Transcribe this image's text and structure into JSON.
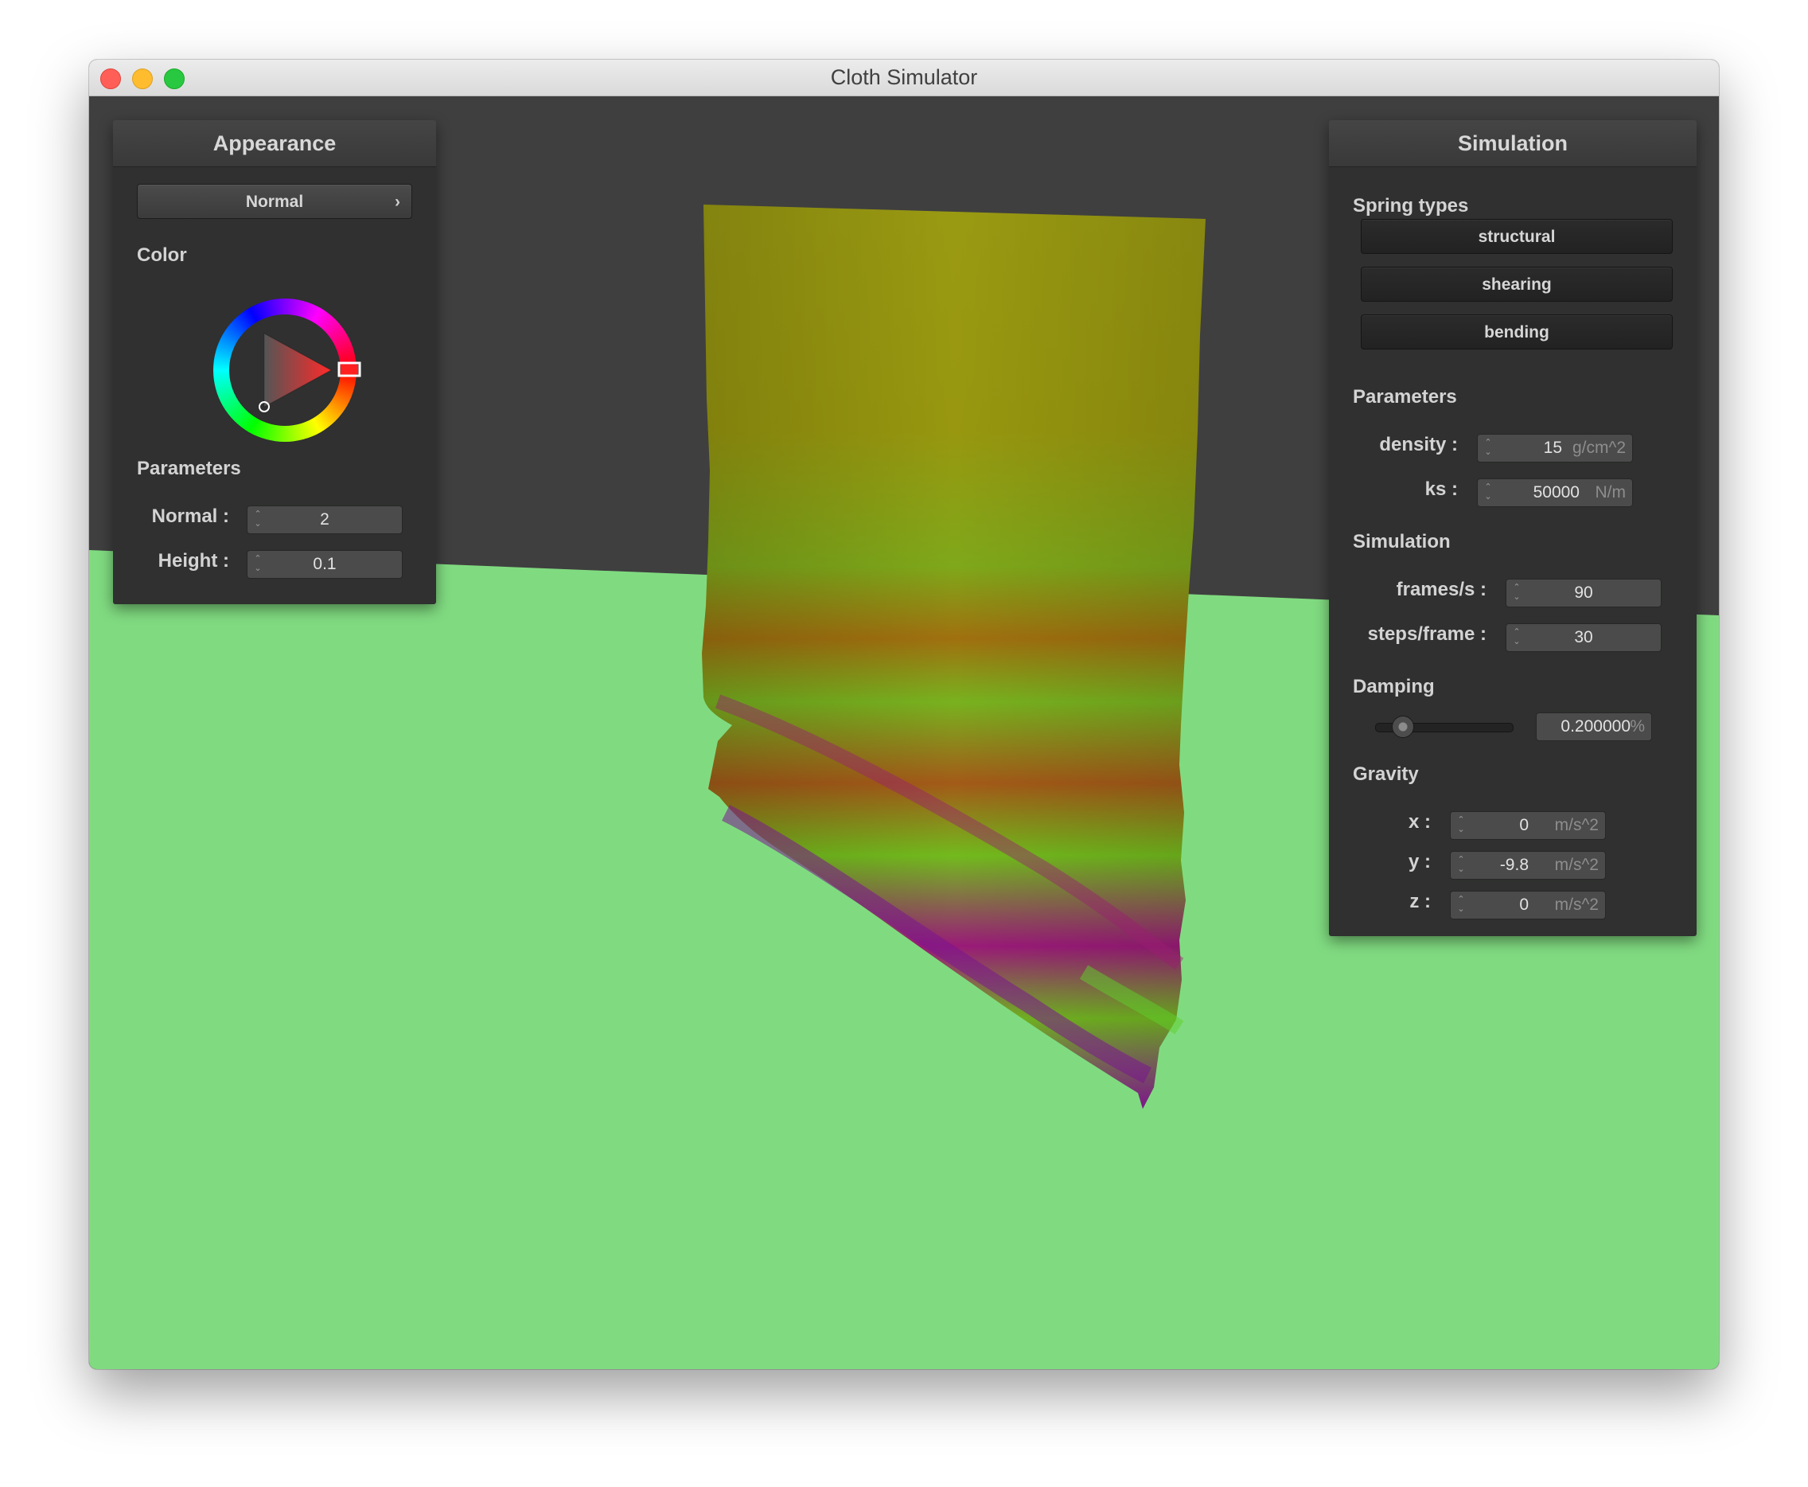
{
  "window": {
    "title": "Cloth Simulator"
  },
  "colors": {
    "sky": "#3f3f3f",
    "ground": "#80db80",
    "panel": "#2f302f"
  },
  "appearance": {
    "header": "Appearance",
    "shader_select": "Normal",
    "color_label": "Color",
    "parameters_label": "Parameters",
    "fields": [
      {
        "label": "Normal :",
        "value": "2"
      },
      {
        "label": "Height :",
        "value": "0.1"
      }
    ]
  },
  "simulation": {
    "header": "Simulation",
    "spring_types_label": "Spring types",
    "springs": [
      "structural",
      "shearing",
      "bending"
    ],
    "parameters_label": "Parameters",
    "params": [
      {
        "label": "density :",
        "value": "15",
        "unit": "g/cm^2"
      },
      {
        "label": "ks :",
        "value": "50000",
        "unit": "N/m"
      }
    ],
    "sim_label": "Simulation",
    "sim": [
      {
        "label": "frames/s :",
        "value": "90"
      },
      {
        "label": "steps/frame :",
        "value": "30"
      }
    ],
    "damping_label": "Damping",
    "damping": {
      "value": "0.200000",
      "unit": "%",
      "level": 0.2
    },
    "gravity_label": "Gravity",
    "gravity": [
      {
        "label": "x :",
        "value": "0",
        "unit": "m/s^2"
      },
      {
        "label": "y :",
        "value": "-9.8",
        "unit": "m/s^2"
      },
      {
        "label": "z :",
        "value": "0",
        "unit": "m/s^2"
      }
    ]
  }
}
